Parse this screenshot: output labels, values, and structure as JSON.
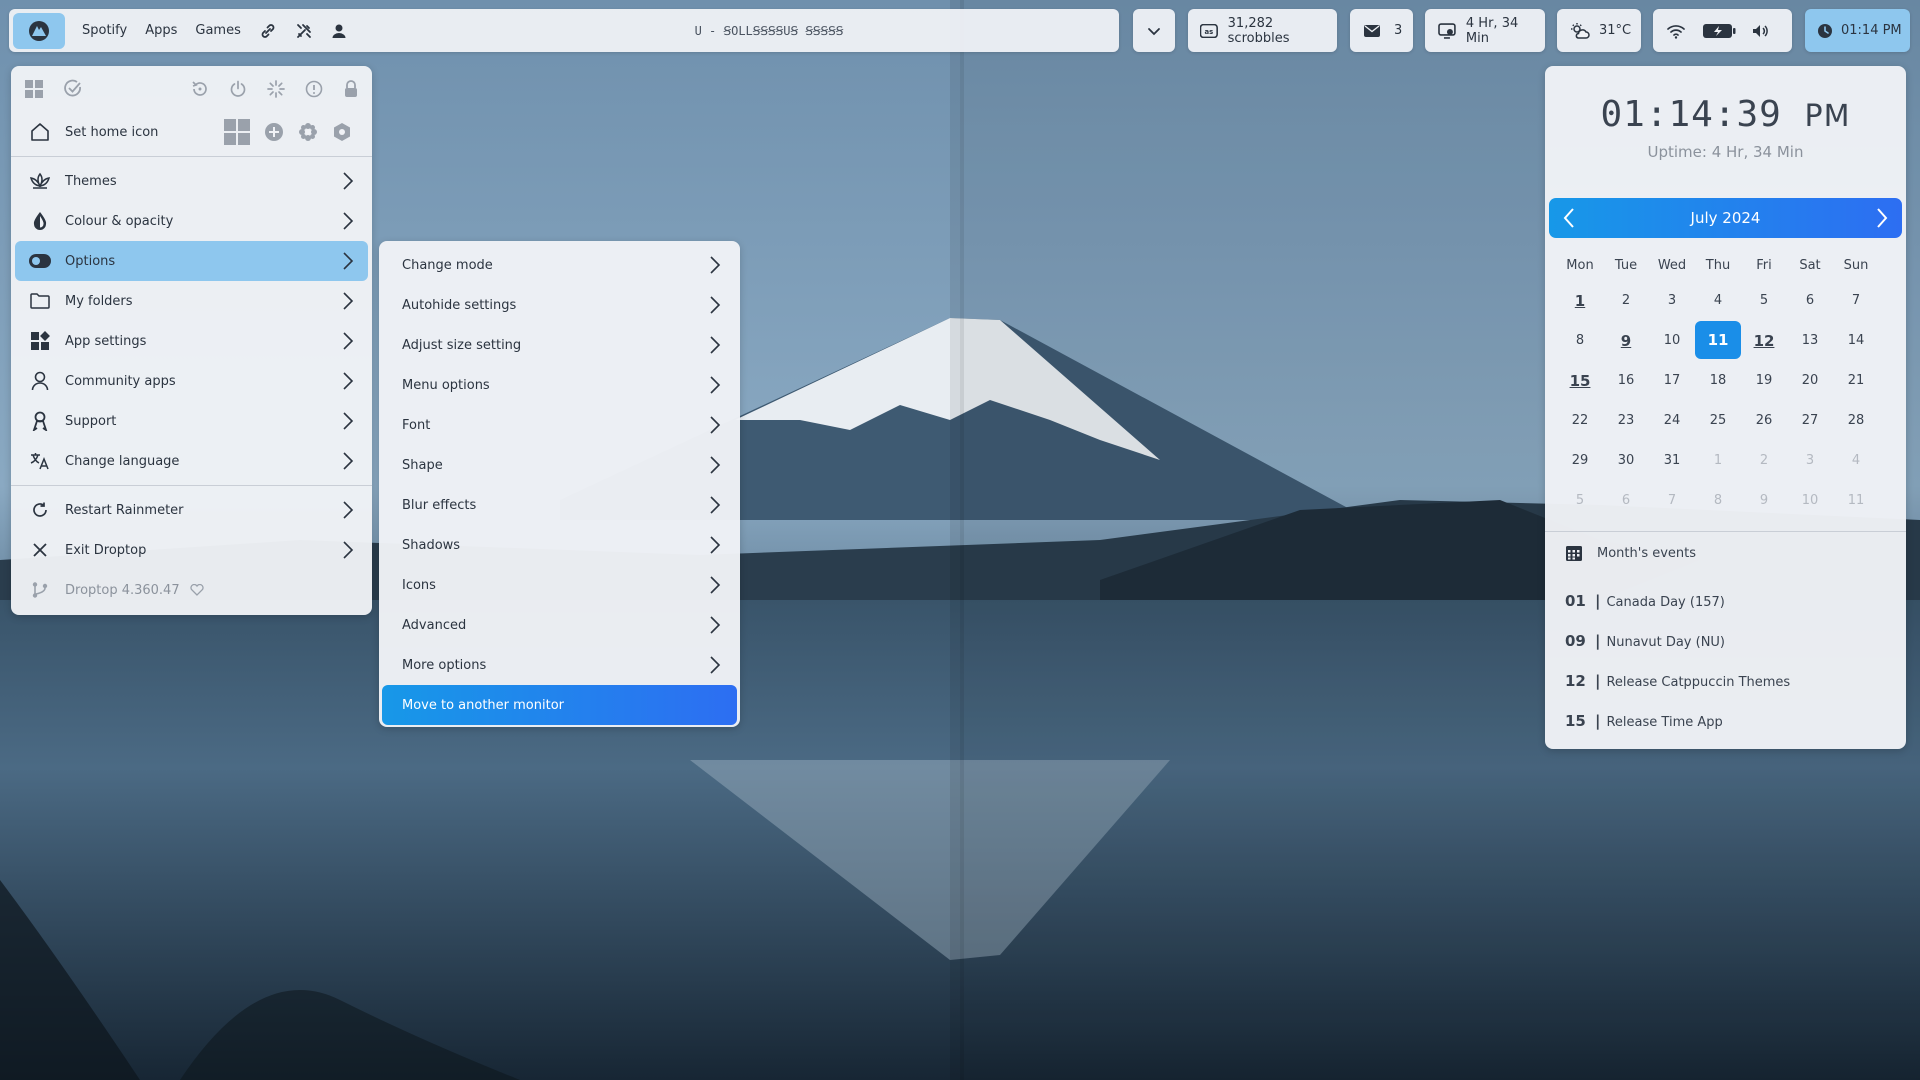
{
  "topbar": {
    "links": [
      "Spotify",
      "Apps",
      "Games"
    ],
    "now_playing": "U - ꞨOLLꞨꞨꞨꞨUꞨ ꞨꞨꞨꞨꞨ",
    "scrobbles": "31,282 scrobbles",
    "mail_count": "3",
    "uptime": "4 Hr, 34 Min",
    "weather": "31°C",
    "clock": "01:14 PM"
  },
  "main_menu": {
    "home_label": "Set home icon",
    "items": [
      "Themes",
      "Colour & opacity",
      "Options",
      "My folders",
      "App settings",
      "Community apps",
      "Support",
      "Change language"
    ],
    "restart": "Restart Rainmeter",
    "exit": "Exit Droptop",
    "version": "Droptop 4.360.47"
  },
  "sub_menu": {
    "items": [
      "Change mode",
      "Autohide settings",
      "Adjust size setting",
      "Menu options",
      "Font",
      "Shape",
      "Blur effects",
      "Shadows",
      "Icons",
      "Advanced",
      "More options"
    ],
    "highlight": "Move to another monitor"
  },
  "calendar": {
    "time": "01:14:39",
    "ampm": "PM",
    "uptime": "Uptime: 4 Hr, 34 Min",
    "month": "July 2024",
    "weekdays": [
      "Mon",
      "Tue",
      "Wed",
      "Thu",
      "Fri",
      "Sat",
      "Sun"
    ],
    "weeks": [
      [
        "1",
        "2",
        "3",
        "4",
        "5",
        "6",
        "7"
      ],
      [
        "8",
        "9",
        "10",
        "11",
        "12",
        "13",
        "14"
      ],
      [
        "15",
        "16",
        "17",
        "18",
        "19",
        "20",
        "21"
      ],
      [
        "22",
        "23",
        "24",
        "25",
        "26",
        "27",
        "28"
      ],
      [
        "29",
        "30",
        "31",
        "1",
        "2",
        "3",
        "4"
      ],
      [
        "5",
        "6",
        "7",
        "8",
        "9",
        "10",
        "11"
      ]
    ],
    "today": "11",
    "event_days": [
      "1",
      "9",
      "12",
      "15"
    ],
    "events_title": "Month's events",
    "events": [
      {
        "day": "01",
        "text": "Canada Day (157)"
      },
      {
        "day": "09",
        "text": "Nunavut Day (NU)"
      },
      {
        "day": "12",
        "text": "Release Catppuccin Themes"
      },
      {
        "day": "15",
        "text": "Release Time App"
      }
    ]
  },
  "colors": {
    "accent": "#1a8ee8",
    "accent_light": "#8ec7ee",
    "panel": "#f0f2f6"
  }
}
